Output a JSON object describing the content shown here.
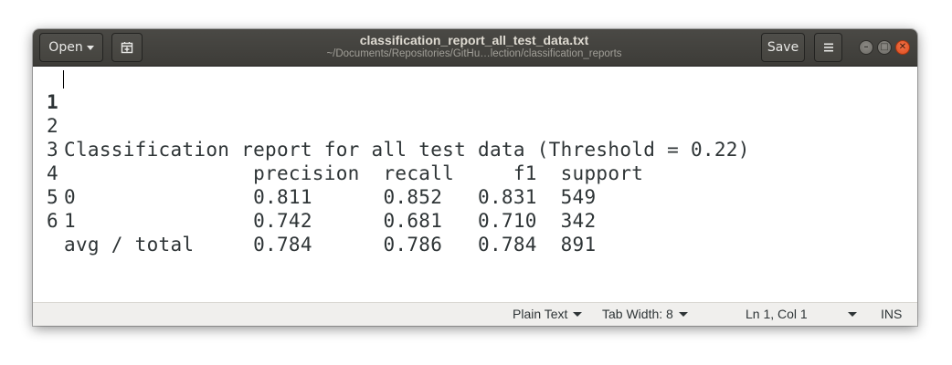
{
  "window": {
    "title": "classification_report_all_test_data.txt",
    "subtitle": "~/Documents/Repositories/GitHu…lection/classification_reports"
  },
  "header": {
    "open_label": "Open",
    "save_label": "Save",
    "new_doc_icon": "new-document-icon",
    "menu_icon": "hamburger-menu-icon"
  },
  "editor": {
    "lines": [
      {
        "number": "1",
        "text": "Classification report for all test data (Threshold = 0.22)"
      },
      {
        "number": "2",
        "text": ""
      },
      {
        "number": "3",
        "text": "                precision  recall     f1  support"
      },
      {
        "number": "4",
        "text": "0               0.811      0.852   0.831  549"
      },
      {
        "number": "5",
        "text": "1               0.742      0.681   0.710  342"
      },
      {
        "number": "6",
        "text": "avg / total     0.784      0.786   0.784  891"
      }
    ],
    "current_line": 1
  },
  "statusbar": {
    "language": "Plain Text",
    "tab_width": "Tab Width: 8",
    "position": "Ln 1, Col 1",
    "mode": "INS"
  },
  "colors": {
    "headerbar": "#3d3c38",
    "close_button": "#e95420",
    "text": "#2e3436",
    "statusbar": "#f0efed"
  }
}
